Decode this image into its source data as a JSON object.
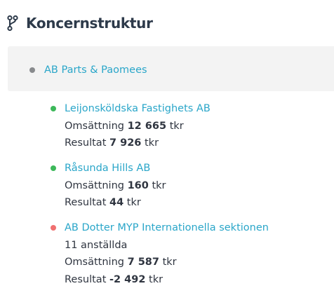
{
  "header": {
    "icon": "branch-icon",
    "title": "Koncernstruktur"
  },
  "parent": {
    "name": "AB Parts & Paomees",
    "status_color": "#888a8d"
  },
  "children": [
    {
      "name": "Leijonsköldska Fastighets AB",
      "status_color": "#3db85a",
      "oms_label": "Omsättning",
      "oms_value": "12 665",
      "oms_unit": "tkr",
      "res_label": "Resultat",
      "res_value": "7 926",
      "res_unit": "tkr"
    },
    {
      "name": "Råsunda Hills AB",
      "status_color": "#3db85a",
      "oms_label": "Omsättning",
      "oms_value": "160",
      "oms_unit": "tkr",
      "res_label": "Resultat",
      "res_value": "44",
      "res_unit": "tkr"
    },
    {
      "name": "AB Dotter MYP Internationella sektionen",
      "status_color": "#f07070",
      "employees": "11 anställda",
      "oms_label": "Omsättning",
      "oms_value": "7 587",
      "oms_unit": "tkr",
      "res_label": "Resultat",
      "res_value": "-2 492",
      "res_unit": "tkr"
    }
  ],
  "colors": {
    "link": "#2aa6c9",
    "title": "#2d3a4a",
    "text": "#2f3540",
    "parent_bg": "#f3f3f3"
  }
}
